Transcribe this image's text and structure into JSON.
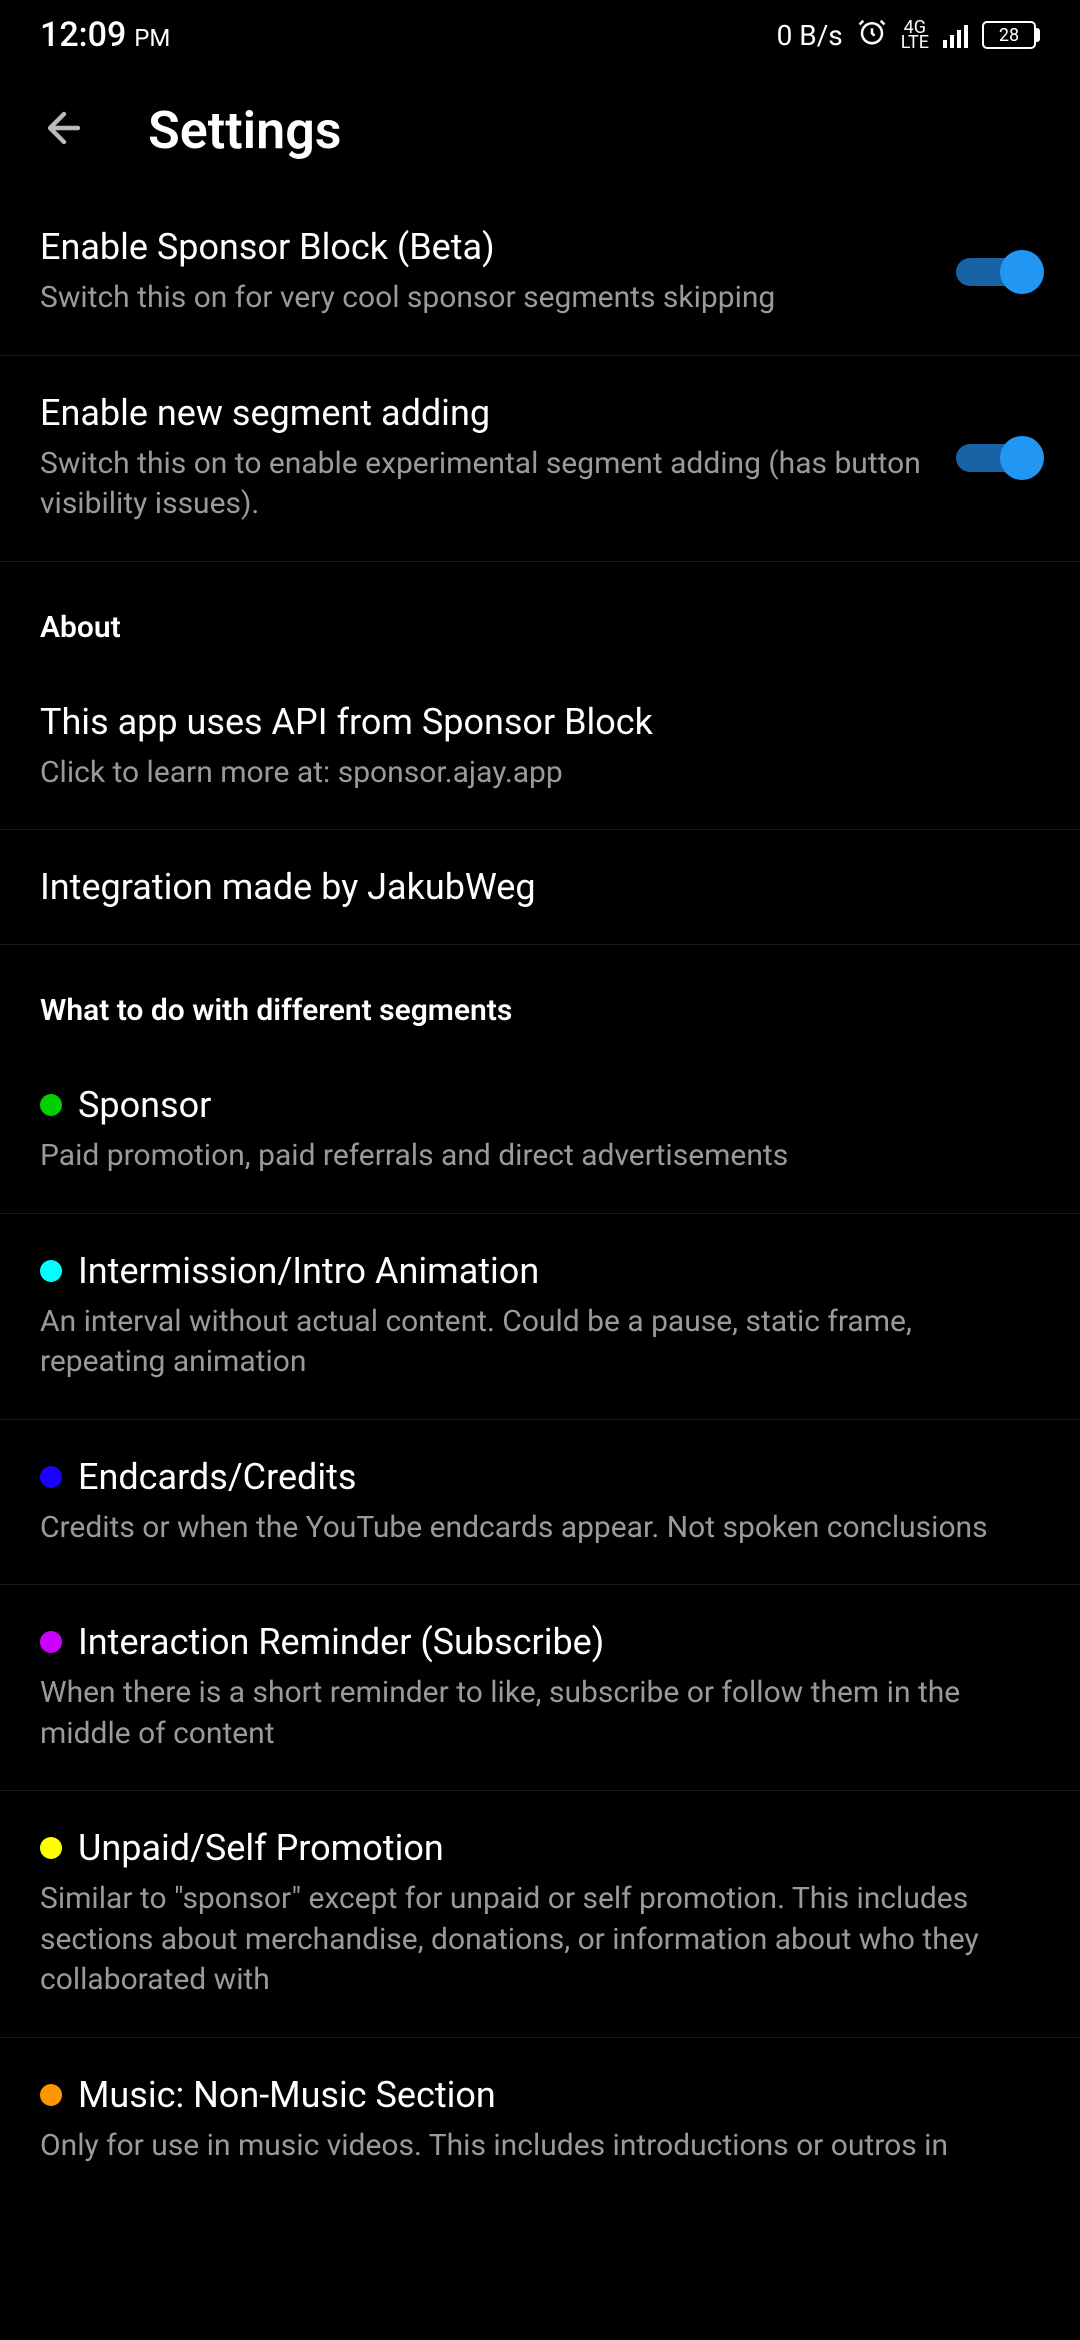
{
  "status": {
    "time": "12:09",
    "ampm": "PM",
    "net_speed": "0 B/s",
    "net_type_top": "4G",
    "net_type_bot": "LTE",
    "battery": "28"
  },
  "header": {
    "title": "Settings"
  },
  "toggles": [
    {
      "title": "Enable Sponsor Block (Beta)",
      "sub": "Switch this on for very cool sponsor segments skipping",
      "on": true
    },
    {
      "title": "Enable new segment adding",
      "sub": "Switch this on to enable experimental segment adding (has button visibility issues).",
      "on": true
    }
  ],
  "about_header": "About",
  "about_rows": [
    {
      "title": "This app uses API from Sponsor Block",
      "sub": "Click to learn more at: sponsor.ajay.app"
    },
    {
      "title": "Integration made by JakubWeg",
      "sub": null
    }
  ],
  "segments_header": "What to do with different segments",
  "segments": [
    {
      "color": "#00d000",
      "title": "Sponsor",
      "sub": "Paid promotion, paid referrals and direct advertisements"
    },
    {
      "color": "#00ffff",
      "title": "Intermission/Intro Animation",
      "sub": "An interval without actual content. Could be a pause, static frame, repeating animation"
    },
    {
      "color": "#1a00ff",
      "title": "Endcards/Credits",
      "sub": "Credits or when the YouTube endcards appear. Not spoken conclusions"
    },
    {
      "color": "#cc00ff",
      "title": "Interaction Reminder (Subscribe)",
      "sub": "When there is a short reminder to like, subscribe or follow them in the middle of content"
    },
    {
      "color": "#ffff00",
      "title": "Unpaid/Self Promotion",
      "sub": "Similar to \"sponsor\" except for unpaid or self promotion. This includes sections about merchandise, donations, or information about who they collaborated with"
    },
    {
      "color": "#ff9500",
      "title": "Music: Non-Music Section",
      "sub": "Only for use in music videos. This includes introductions or outros in"
    }
  ]
}
